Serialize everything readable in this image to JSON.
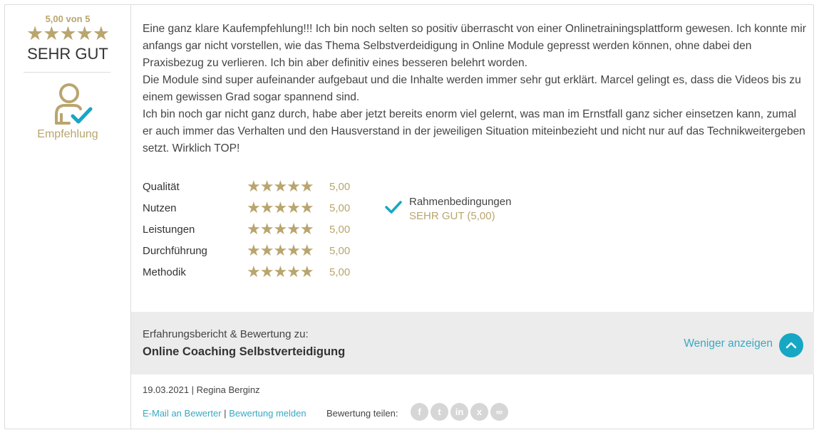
{
  "summary": {
    "score_text": "5,00 von 5",
    "stars": "★★★★★",
    "label": "SEHR GUT",
    "recommendation_label": "Empfehlung"
  },
  "review": {
    "paragraphs": [
      "Eine ganz klare Kaufempfehlung!!! Ich bin noch selten so positiv überrascht von einer Onlinetrainingsplattform gewesen. Ich konnte mir anfangs gar nicht vorstellen, wie das Thema Selbstverdeidigung in Online Module gepresst werden können, ohne dabei den Praxisbezug zu verlieren. Ich bin aber definitiv eines besseren belehrt worden.",
      "Die Module sind super aufeinander aufgebaut und die Inhalte werden immer sehr gut erklärt. Marcel gelingt es, dass die Videos bis zu einem gewissen Grad sogar spannend sind.",
      "Ich bin noch gar nicht ganz durch, habe aber jetzt bereits enorm viel gelernt, was man im Ernstfall ganz sicher einsetzen kann, zumal er auch immer das Verhalten und den Hausverstand in der jeweiligen Situation miteinbezieht und nicht nur auf das Technikweitergeben setzt. Wirklich TOP!"
    ]
  },
  "ratings": [
    {
      "label": "Qualität",
      "stars": "★★★★★",
      "value": "5,00"
    },
    {
      "label": "Nutzen",
      "stars": "★★★★★",
      "value": "5,00"
    },
    {
      "label": "Leistungen",
      "stars": "★★★★★",
      "value": "5,00"
    },
    {
      "label": "Durchführung",
      "stars": "★★★★★",
      "value": "5,00"
    },
    {
      "label": "Methodik",
      "stars": "★★★★★",
      "value": "5,00"
    }
  ],
  "conditions": {
    "title": "Rahmenbedingungen",
    "value": "SEHR GUT (5,00)",
    "icon": "check-icon"
  },
  "course": {
    "prefix": "Erfahrungsbericht & Bewertung zu:",
    "name": "Online Coaching Selbstverteidigung",
    "toggle_label": "Weniger anzeigen",
    "toggle_icon": "chevron-up-icon"
  },
  "meta": {
    "line": "19.03.2021 | Regina Berginz"
  },
  "footer": {
    "email_link": "E-Mail an Bewerter",
    "separator": "|",
    "report_link": "Bewertung melden",
    "share_label": "Bewertung teilen:",
    "share_icons": [
      "facebook-icon",
      "twitter-icon",
      "linkedin-icon",
      "xing-icon",
      "link-icon"
    ]
  },
  "colors": {
    "gold": "#b9a56e",
    "accent": "#16a7c4",
    "link": "#37a9c3",
    "panel": "#ececec"
  }
}
